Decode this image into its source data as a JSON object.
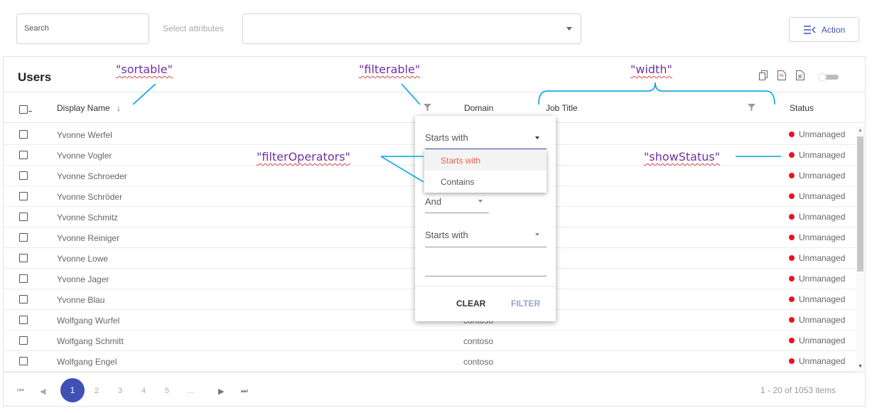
{
  "toolbar": {
    "search_placeholder": "Search",
    "select_attributes_label": "Select attributes",
    "action_label": "Action"
  },
  "grid": {
    "title": "Users",
    "tools": [
      "copy-icon",
      "pdf-icon",
      "excel-icon",
      "toggle-switch"
    ],
    "columns": {
      "display_name": "Display Name",
      "domain": "Domain",
      "job_title": "Job Title",
      "status": "Status"
    },
    "rows": [
      {
        "name": "Yvonne Werfel",
        "domain": "",
        "status": "Unmanaged"
      },
      {
        "name": "Yvonne Vogler",
        "domain": "",
        "status": "Unmanaged"
      },
      {
        "name": "Yvonne Schroeder",
        "domain": "",
        "status": "Unmanaged"
      },
      {
        "name": "Yvonne Schröder",
        "domain": "",
        "status": "Unmanaged"
      },
      {
        "name": "Yvonne Schmitz",
        "domain": "",
        "status": "Unmanaged"
      },
      {
        "name": "Yvonne Reiniger",
        "domain": "",
        "status": "Unmanaged"
      },
      {
        "name": "Yvonne Lowe",
        "domain": "",
        "status": "Unmanaged"
      },
      {
        "name": "Yvonne Jager",
        "domain": "",
        "status": "Unmanaged"
      },
      {
        "name": "Yvonne Blau",
        "domain": "",
        "status": "Unmanaged"
      },
      {
        "name": "Wolfgang Wurfel",
        "domain": "contoso",
        "status": "Unmanaged"
      },
      {
        "name": "Wolfgang Schmitt",
        "domain": "contoso",
        "status": "Unmanaged"
      },
      {
        "name": "Wolfgang Engel",
        "domain": "contoso",
        "status": "Unmanaged"
      }
    ],
    "status_color": "#e8131f"
  },
  "pager": {
    "pages": [
      "1",
      "2",
      "3",
      "4",
      "5",
      "..."
    ],
    "current_page": "1",
    "info": "1 - 20 of 1053 items"
  },
  "filter_popup": {
    "operator1": "Starts with",
    "logic": "And",
    "operator2": "Starts with",
    "clear_label": "CLEAR",
    "filter_label": "FILTER",
    "dropdown_options": [
      "Starts with",
      "Contains"
    ]
  },
  "annotations": {
    "sortable": "\"sortable\"",
    "filterable": "\"filterable\"",
    "width": "\"width\"",
    "filter_operators": "\"filterOperators\"",
    "show_status": "\"showStatus\""
  },
  "colors": {
    "accent": "#3f51b5",
    "annotation_text": "#7030a0",
    "annotation_line": "#00a2e8",
    "dropdown_selected_text": "#f2624d"
  }
}
